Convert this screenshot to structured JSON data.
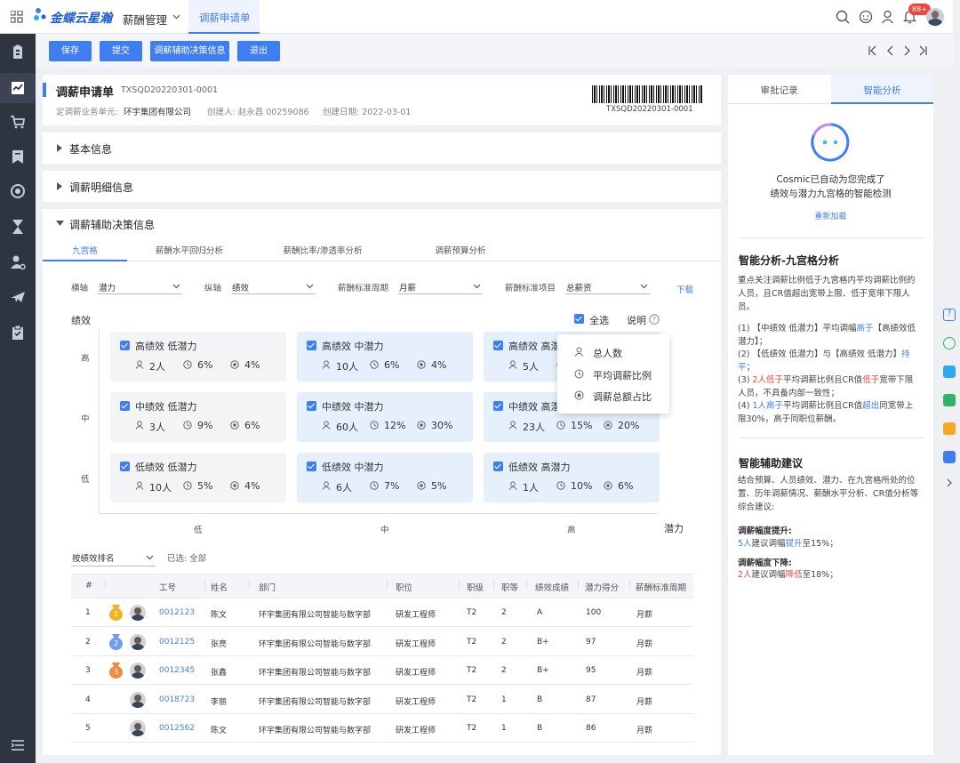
{
  "brand": {
    "name": "金蝶云星瀚",
    "module": "薪酬管理",
    "active_tab": "调薪申请单"
  },
  "header": {
    "badge": "88+"
  },
  "toolbar": {
    "save": "保存",
    "submit": "提交",
    "aux_info": "调薪辅助决策信息",
    "exit": "退出"
  },
  "doc": {
    "title": "调薪申请单",
    "number": "TXSQD20220301-0001",
    "org_label": "定调薪业务单元:",
    "org_value": "环宇集团有限公司",
    "creator": "创建人: 赵永昌 00259086",
    "created": "创建日期: 2022-03-01",
    "barcode_text": "TXSQD20220301-0001"
  },
  "sections": {
    "basic": "基本信息",
    "detail": "调薪明细信息",
    "aux": "调薪辅助决策信息"
  },
  "subtabs": [
    "九宫格",
    "薪酬水平回归分析",
    "薪酬比率/渗透率分析",
    "调薪预算分析"
  ],
  "filters": {
    "x_label": "横轴",
    "x_value": "潜力",
    "y_label": "纵轴",
    "y_value": "绩效",
    "period_label": "薪酬标准周期",
    "period_value": "月薪",
    "item_label": "薪酬标准项目",
    "item_value": "总薪资",
    "download": "下载"
  },
  "grid": {
    "y_title": "绩效",
    "x_title": "潜力",
    "select_all": "全选",
    "explain": "说明",
    "y_ticks": [
      "高",
      "中",
      "低"
    ],
    "x_ticks": [
      "低",
      "中",
      "高"
    ],
    "cells": [
      {
        "title": "高绩效 低潜力",
        "count": "2人",
        "avg": "6%",
        "share": "4%"
      },
      {
        "title": "高绩效 中潜力",
        "count": "10人",
        "avg": "6%",
        "share": "4%"
      },
      {
        "title": "高绩效 高潜力",
        "count": "5人",
        "avg": "",
        "share": ""
      },
      {
        "title": "中绩效 低潜力",
        "count": "3人",
        "avg": "9%",
        "share": "6%"
      },
      {
        "title": "中绩效 中潜力",
        "count": "60人",
        "avg": "12%",
        "share": "30%"
      },
      {
        "title": "中绩效 高潜",
        "count": "23人",
        "avg": "15%",
        "share": "20%"
      },
      {
        "title": "低绩效 低潜力",
        "count": "10人",
        "avg": "5%",
        "share": "4%"
      },
      {
        "title": "低绩效 中潜力",
        "count": "6人",
        "avg": "7%",
        "share": "5%"
      },
      {
        "title": "低绩效 高潜力",
        "count": "1人",
        "avg": "10%",
        "share": "6%"
      }
    ],
    "legend": [
      "总人数",
      "平均调薪比例",
      "调薪总额占比"
    ]
  },
  "ranking": {
    "sort_value": "按绩效排名",
    "selected": "已选: 全部"
  },
  "table": {
    "headers": [
      "#",
      "工号",
      "姓名",
      "部门",
      "职位",
      "职级",
      "职等",
      "绩效成绩",
      "潜力得分",
      "薪酬标准周期"
    ],
    "rows": [
      {
        "n": "1",
        "id": "0012123",
        "name": "陈文",
        "dept": "环宇集团有限公司智能与数字部",
        "pos": "研发工程师",
        "grade": "T2",
        "level": "2",
        "perf": "A",
        "pot": "100",
        "period": "月薪",
        "medal": "1"
      },
      {
        "n": "2",
        "id": "0012125",
        "name": "张亮",
        "dept": "环宇集团有限公司智能与数字部",
        "pos": "研发工程师",
        "grade": "T2",
        "level": "2",
        "perf": "B+",
        "pot": "97",
        "period": "月薪",
        "medal": "2"
      },
      {
        "n": "3",
        "id": "0012345",
        "name": "张鑫",
        "dept": "环宇集团有限公司智能与数字部",
        "pos": "研发工程师",
        "grade": "T2",
        "level": "2",
        "perf": "B+",
        "pot": "95",
        "period": "月薪",
        "medal": "3"
      },
      {
        "n": "4",
        "id": "0018723",
        "name": "李丽",
        "dept": "环宇集团有限公司智能与数字部",
        "pos": "研发工程师",
        "grade": "T2",
        "level": "1",
        "perf": "B",
        "pot": "87",
        "period": "月薪",
        "medal": ""
      },
      {
        "n": "5",
        "id": "0012562",
        "name": "陈文",
        "dept": "环宇集团有限公司智能与数字部",
        "pos": "研发工程师",
        "grade": "T2",
        "level": "1",
        "perf": "B",
        "pot": "86",
        "period": "月薪",
        "medal": ""
      }
    ]
  },
  "right": {
    "tabs": [
      "审批记录",
      "智能分析"
    ],
    "msg1": "Cosmic已自动为您完成了",
    "msg2": "绩效与潜力九宫格的智能检测",
    "reload": "重新加载",
    "title1": "智能分析-九宫格分析",
    "intro": "重点关注调薪比例低于九宫格内平均调薪比例的人员，且CR值超出宽带上限、低于宽带下限人员。",
    "title2": "智能辅助建议",
    "advice": "结合预算、人员绩效、潜力、在九宫格所处的位置、历年调薪情况、薪酬水平分析、CR值分析等综合建议:",
    "up_title": "调薪幅度提升:",
    "down_title": "调薪幅度下降:"
  }
}
